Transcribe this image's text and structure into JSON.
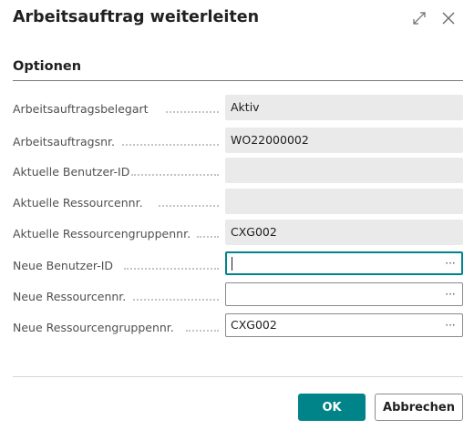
{
  "dialog": {
    "title": "Arbeitsauftrag weiterleiten",
    "icons": {
      "expand": "expand-arrows-icon",
      "close": "close-icon"
    }
  },
  "section": {
    "title": "Optionen"
  },
  "fields": [
    {
      "label": "Arbeitsauftragsbelegart",
      "value": "Aktiv",
      "editable": false
    },
    {
      "label": "Arbeitsauftragsnr.",
      "value": "WO22000002",
      "editable": false
    },
    {
      "label": "Aktuelle Benutzer-ID",
      "value": "",
      "editable": false
    },
    {
      "label": "Aktuelle Ressourcennr.",
      "value": "",
      "editable": false
    },
    {
      "label": "Aktuelle Ressourcengruppennr.",
      "value": "CXG002",
      "editable": false
    },
    {
      "label": "Neue Benutzer-ID",
      "value": "",
      "editable": true,
      "focused": true,
      "lookup": "···"
    },
    {
      "label": "Neue Ressourcennr.",
      "value": "",
      "editable": true,
      "lookup": "···"
    },
    {
      "label": "Neue Ressourcengruppennr.",
      "value": "CXG002",
      "editable": true,
      "lookup": "···"
    }
  ],
  "buttons": {
    "ok": "OK",
    "cancel": "Abbrechen"
  },
  "colors": {
    "accent": "#008489",
    "readonly_bg": "#eaeaea",
    "label": "#505050"
  }
}
